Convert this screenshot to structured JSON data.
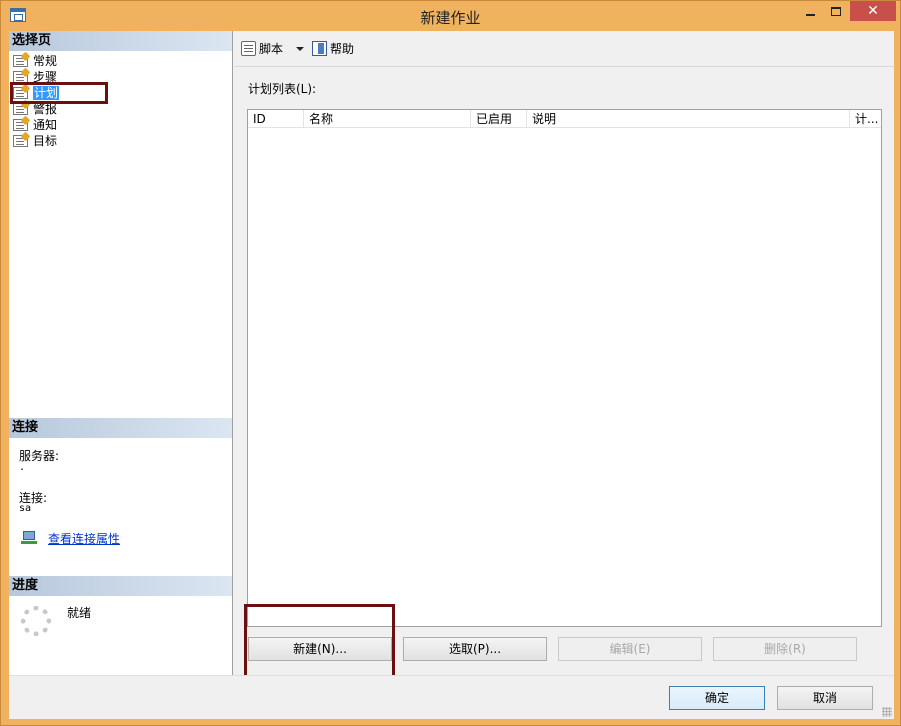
{
  "window": {
    "title": "新建作业",
    "close_glyph": "✕"
  },
  "left": {
    "select_page_header": "选择页",
    "pages": [
      {
        "label": "常规"
      },
      {
        "label": "步骤"
      },
      {
        "label": "计划"
      },
      {
        "label": "警报"
      },
      {
        "label": "通知"
      },
      {
        "label": "目标"
      }
    ],
    "connection_header": "连接",
    "server_label": "服务器:",
    "server_value": ".",
    "connection_label": "连接:",
    "connection_value": "sa",
    "view_connection_link": "查看连接属性",
    "progress_header": "进度",
    "progress_status": "就绪"
  },
  "toolbar": {
    "script_label": "脚本",
    "help_label": "帮助"
  },
  "schedule": {
    "list_label": "计划列表(L):",
    "columns": [
      "ID",
      "名称",
      "已启用",
      "说明",
      "计..."
    ],
    "buttons": {
      "new": "新建(N)...",
      "pick": "选取(P)...",
      "edit": "编辑(E)",
      "delete": "删除(R)"
    }
  },
  "footer": {
    "ok": "确定",
    "cancel": "取消"
  },
  "colors": {
    "title_bar": "#f0b25e",
    "selection": "#3399ff",
    "highlight_box": "#6b1010",
    "close_button": "#c7504a"
  }
}
